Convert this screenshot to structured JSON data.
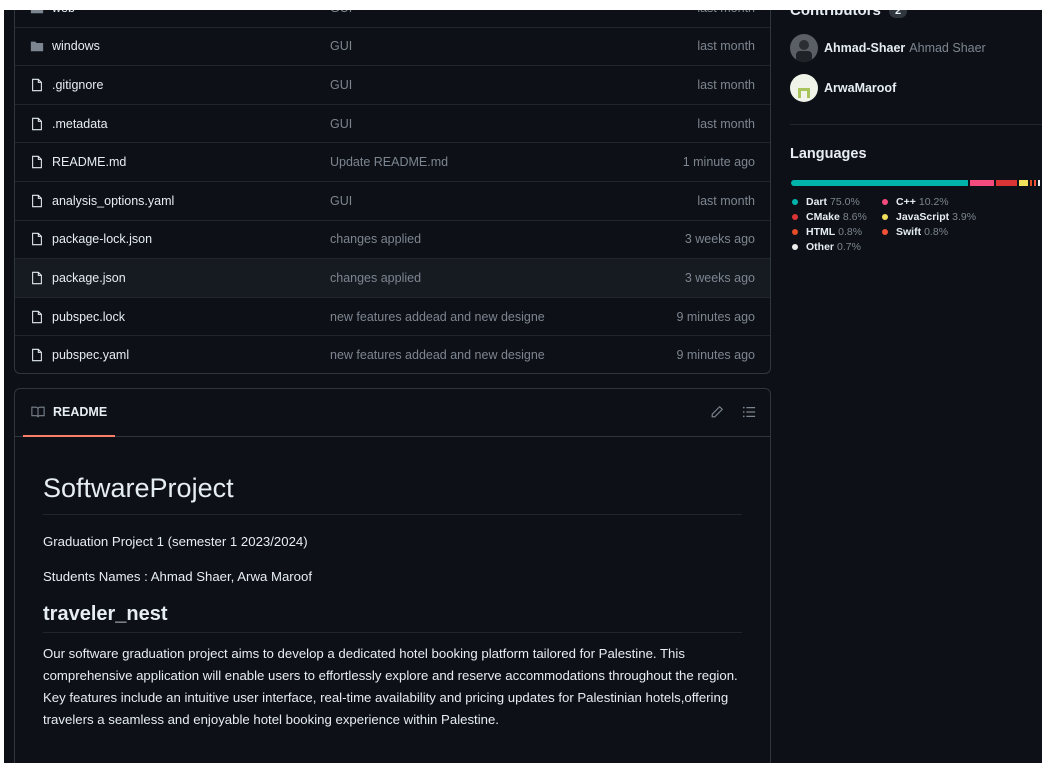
{
  "files": [
    {
      "name": "web",
      "type": "folder",
      "message": "GUI",
      "date": "last month"
    },
    {
      "name": "windows",
      "type": "folder",
      "message": "GUI",
      "date": "last month"
    },
    {
      "name": ".gitignore",
      "type": "file",
      "message": "GUI",
      "date": "last month"
    },
    {
      "name": ".metadata",
      "type": "file",
      "message": "GUI",
      "date": "last month"
    },
    {
      "name": "README.md",
      "type": "file",
      "message": "Update README.md",
      "date": "1 minute ago"
    },
    {
      "name": "analysis_options.yaml",
      "type": "file",
      "message": "GUI",
      "date": "last month"
    },
    {
      "name": "package-lock.json",
      "type": "file",
      "message": "changes applied",
      "date": "3 weeks ago"
    },
    {
      "name": "package.json",
      "type": "file",
      "message": "changes applied",
      "date": "3 weeks ago"
    },
    {
      "name": "pubspec.lock",
      "type": "file",
      "message": "new features addead and new designe",
      "date": "9 minutes ago"
    },
    {
      "name": "pubspec.yaml",
      "type": "file",
      "message": "new features addead and new designe",
      "date": "9 minutes ago"
    }
  ],
  "readme": {
    "tab_label": "README",
    "tab_icon": "book-icon",
    "edit_icon": "pencil-icon",
    "outline_icon": "list-icon",
    "title": "SoftwareProject",
    "line1": "Graduation Project 1 (semester 1 2023/2024)",
    "line2": "Students Names : Ahmad Shaer, Arwa Maroof",
    "subtitle": "traveler_nest",
    "paragraph": "Our software graduation project aims to develop a dedicated hotel booking platform tailored for Palestine. This comprehensive application will enable users to effortlessly explore and reserve accommodations throughout the region. Key features include an intuitive user interface, real-time availability and pricing updates for Palestinian hotels,offering travelers a seamless and enjoyable hotel booking experience within Palestine."
  },
  "sidebar": {
    "contributors_title": "Contributors",
    "contributors_count": "2",
    "contributors": [
      {
        "login": "Ahmad-Shaer",
        "name": "Ahmad Shaer"
      },
      {
        "login": "ArwaMaroof",
        "name": ""
      }
    ],
    "languages_title": "Languages",
    "languages": [
      {
        "name": "Dart",
        "percent": "75.0%",
        "value": 75.0,
        "color": "#00b4ab"
      },
      {
        "name": "C++",
        "percent": "10.2%",
        "value": 10.2,
        "color": "#f34b7d"
      },
      {
        "name": "CMake",
        "percent": "8.6%",
        "value": 8.6,
        "color": "#da3434"
      },
      {
        "name": "JavaScript",
        "percent": "3.9%",
        "value": 3.9,
        "color": "#f1e05a"
      },
      {
        "name": "HTML",
        "percent": "0.8%",
        "value": 0.8,
        "color": "#e34c26"
      },
      {
        "name": "Swift",
        "percent": "0.8%",
        "value": 0.8,
        "color": "#f05138"
      },
      {
        "name": "Other",
        "percent": "0.7%",
        "value": 0.7,
        "color": "#ededed"
      }
    ]
  },
  "colors": {
    "background": "#0d1117",
    "border": "#30363d",
    "muted_text": "#7d8590",
    "accent_underline": "#f78166"
  }
}
